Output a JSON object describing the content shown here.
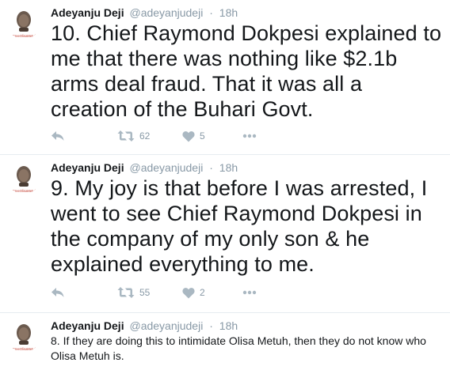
{
  "tweets": [
    {
      "name": "Adeyanju Deji",
      "handle": "@adeyanjudeji",
      "separator": "·",
      "time": "18h",
      "avatar_caption": "#FreeOlisaMetuh",
      "text": "10. Chief Raymond Dokpesi explained to me that there was nothing like $2.1b arms deal fraud. That it was all a creation of the Buhari Govt.",
      "retweets": "62",
      "likes": "5"
    },
    {
      "name": "Adeyanju Deji",
      "handle": "@adeyanjudeji",
      "separator": "·",
      "time": "18h",
      "avatar_caption": "#FreeOlisaMetuh",
      "text": "9. My joy is that before I was arrested, I went to see Chief Raymond Dokpesi in the company of my only son & he explained everything to me.",
      "retweets": "55",
      "likes": "2"
    },
    {
      "name": "Adeyanju Deji",
      "handle": "@adeyanjudeji",
      "separator": "·",
      "time": "18h",
      "avatar_caption": "#FreeOlisaMetuh",
      "text": "8. If they are doing this to intimidate Olisa Metuh, then they do not know who Olisa Metuh is."
    }
  ],
  "icons": {
    "reply": "reply-icon",
    "retweet": "retweet-icon",
    "like": "heart-icon",
    "more": "more-icon"
  },
  "colors": {
    "text": "#14171a",
    "secondary": "#8899a6",
    "icon": "#aab8c2",
    "divider": "#e6ecf0"
  }
}
